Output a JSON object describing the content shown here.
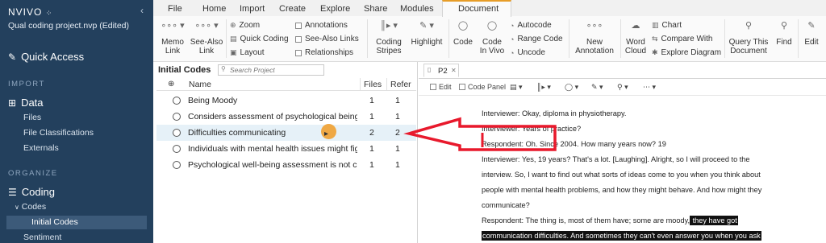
{
  "sidebar": {
    "brand": "NVIVO",
    "collapse_glyph": "‹",
    "project": "Qual coding project.nvp (Edited)",
    "quick_access": "Quick Access",
    "section_import": "IMPORT",
    "data_group": "Data",
    "data_items": [
      "Files",
      "File Classifications",
      "Externals"
    ],
    "section_organize": "ORGANIZE",
    "coding_group": "Coding",
    "codes_label": "Codes",
    "initial_codes": "Initial Codes",
    "sentiment": "Sentiment"
  },
  "ribbon": {
    "tabs": [
      "File",
      "Home",
      "Import",
      "Create",
      "Explore",
      "Share",
      "Modules"
    ],
    "active_tab": "Document",
    "memo_link": [
      "Memo",
      "Link"
    ],
    "see_also_link": [
      "See-Also",
      "Link"
    ],
    "zoom": "Zoom",
    "quick_coding": "Quick Coding",
    "layout": "Layout",
    "annotations": "Annotations",
    "see_also_links": "See-Also Links",
    "relationships": "Relationships",
    "coding_stripes": [
      "Coding",
      "Stripes"
    ],
    "highlight": "Highlight",
    "code": "Code",
    "code_in_vivo": [
      "Code",
      "In Vivo"
    ],
    "autocode": "Autocode",
    "range_code": "Range Code",
    "uncode": "Uncode",
    "new_annotation": [
      "New",
      "Annotation"
    ],
    "word_cloud": [
      "Word",
      "Cloud"
    ],
    "chart": "Chart",
    "compare_with": "Compare With",
    "explore_diagram": "Explore Diagram",
    "query_this_document": [
      "Query This",
      "Document"
    ],
    "find": "Find",
    "edit": "Edit"
  },
  "codes_panel": {
    "title": "Initial Codes",
    "search_placeholder": "Search Project",
    "col_name": "Name",
    "col_files": "Files",
    "col_refs": "Refer",
    "rows": [
      {
        "name": "Being Moody",
        "files": "1",
        "refs": "1"
      },
      {
        "name": "Considers assessment of psychological being a",
        "files": "1",
        "refs": "1"
      },
      {
        "name": "Difficulties communicating",
        "files": "2",
        "refs": "2"
      },
      {
        "name": "Individuals with mental health issues might fig",
        "files": "1",
        "refs": "1"
      },
      {
        "name": "Psychological well-being assessment is not cur",
        "files": "1",
        "refs": "1"
      }
    ]
  },
  "document": {
    "tab": "P2",
    "tools": {
      "edit": "Edit",
      "code_panel": "Code Panel"
    },
    "lines": [
      "Interviewer: Okay, diploma in physiotherapy.",
      "Interviewer: Years of practice?",
      "Respondent: Oh. Since 2004. How many years now? 19",
      "Interviewer: Yes, 19 years? That's a lot. [Laughing]. Alright, so I will proceed to the",
      "interview. So, I want to find out what sorts of ideas come to you when you think about",
      "people with mental health problems, and how they might behave. And how might they",
      "communicate?"
    ],
    "line8_plain": "Respondent: The thing is, most of them have; some are moody,",
    "line8_highlight": " they have got",
    "line9_highlight": "communication difficulties. And sometimes they can't even answer you when you ask"
  },
  "colors": {
    "sidebar": "#23405d",
    "selected_row": "#e6f1f8",
    "annotation_red": "#e8192c",
    "cursor": "#f0a030",
    "active_tab_accent": "#e79d28"
  }
}
